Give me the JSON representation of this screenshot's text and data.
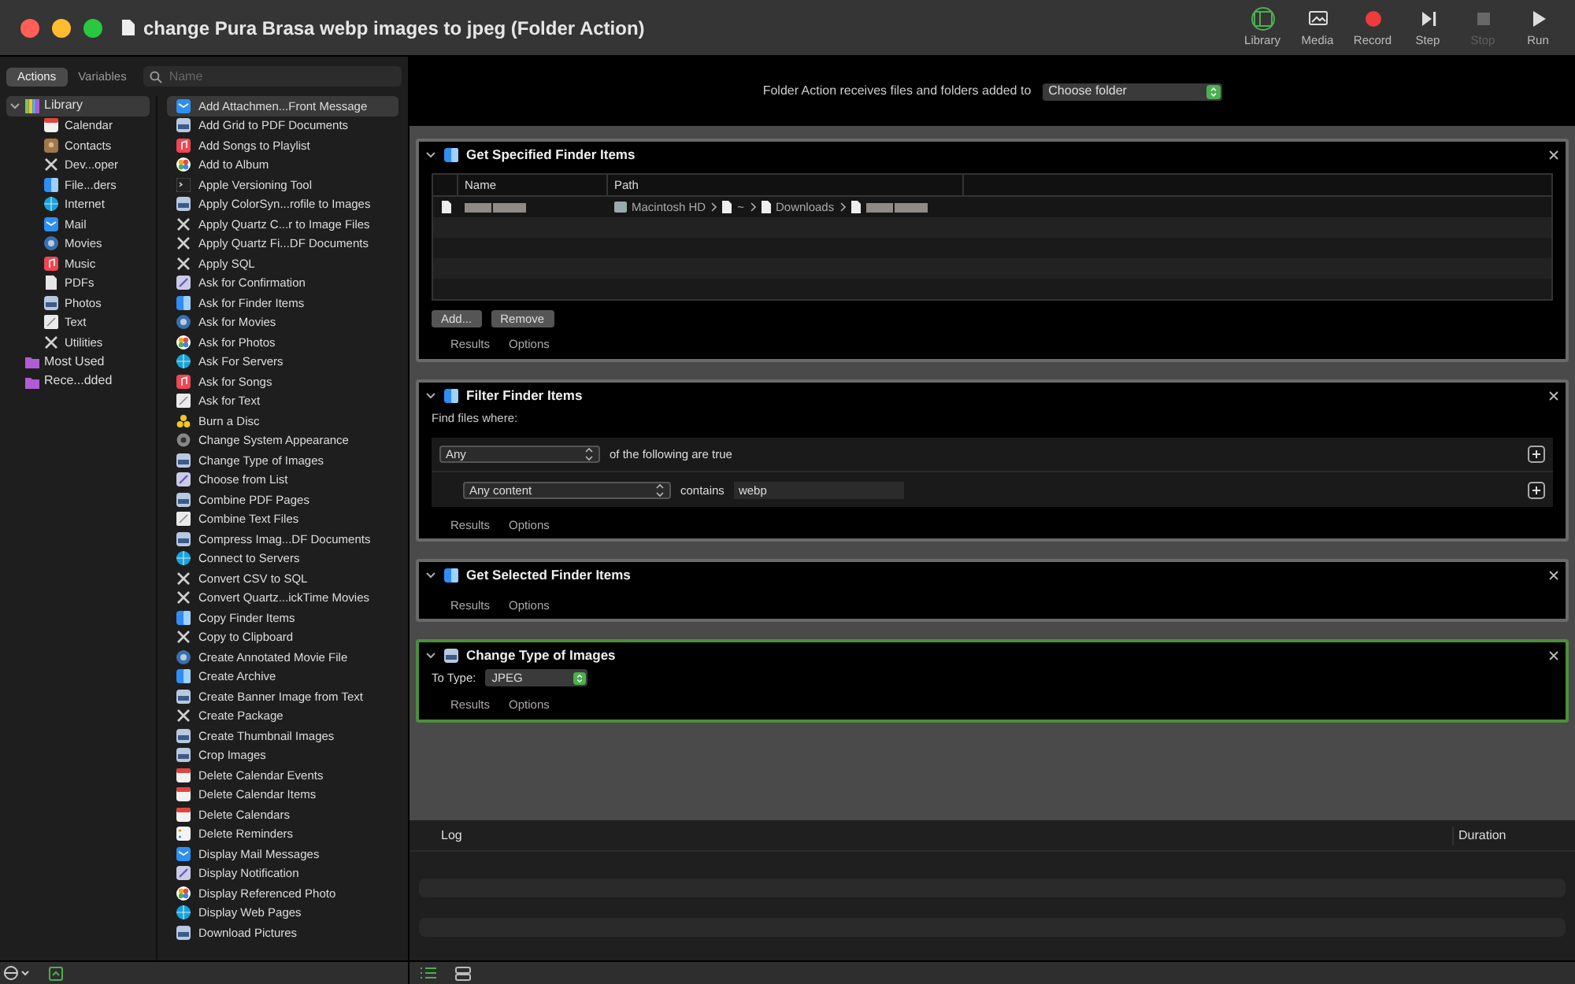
{
  "window": {
    "title": "change Pura Brasa webp images to jpeg (Folder Action)"
  },
  "toolbar": [
    {
      "label": "Library",
      "kind": "library",
      "selected": true,
      "disabled": false
    },
    {
      "label": "Media",
      "kind": "media",
      "selected": false,
      "disabled": false
    },
    {
      "label": "Record",
      "kind": "record",
      "selected": false,
      "disabled": false
    },
    {
      "label": "Step",
      "kind": "step",
      "selected": false,
      "disabled": false
    },
    {
      "label": "Stop",
      "kind": "stop",
      "selected": false,
      "disabled": true
    },
    {
      "label": "Run",
      "kind": "run",
      "selected": false,
      "disabled": false
    }
  ],
  "sidebar_tabs": [
    {
      "label": "Actions",
      "selected": true
    },
    {
      "label": "Variables",
      "selected": false
    }
  ],
  "search": {
    "placeholder": "Name"
  },
  "library": [
    {
      "label": "Library",
      "kind": "library",
      "selected": true,
      "expanded": true,
      "children": [
        {
          "label": "Calendar",
          "kind": "calendar"
        },
        {
          "label": "Contacts",
          "kind": "contacts"
        },
        {
          "label": "Dev...oper",
          "kind": "tools"
        },
        {
          "label": "File...ders",
          "kind": "finder"
        },
        {
          "label": "Internet",
          "kind": "internet"
        },
        {
          "label": "Mail",
          "kind": "mail"
        },
        {
          "label": "Movies",
          "kind": "movies"
        },
        {
          "label": "Music",
          "kind": "music"
        },
        {
          "label": "PDFs",
          "kind": "pdf"
        },
        {
          "label": "Photos",
          "kind": "preview"
        },
        {
          "label": "Text",
          "kind": "text"
        },
        {
          "label": "Utilities",
          "kind": "tools"
        }
      ]
    },
    {
      "label": "Most Used",
      "kind": "folder",
      "selected": false
    },
    {
      "label": "Rece...dded",
      "kind": "folder",
      "selected": false
    }
  ],
  "actions": [
    {
      "label": "Add Attachmen...Front Message",
      "kind": "mail",
      "selected": true
    },
    {
      "label": "Add Grid to PDF Documents",
      "kind": "preview",
      "selected": false
    },
    {
      "label": "Add Songs to Playlist",
      "kind": "music",
      "selected": false
    },
    {
      "label": "Add to Album",
      "kind": "photos",
      "selected": false
    },
    {
      "label": "Apple Versioning Tool",
      "kind": "terminal",
      "selected": false
    },
    {
      "label": "Apply ColorSyn...rofile to Images",
      "kind": "preview",
      "selected": false
    },
    {
      "label": "Apply Quartz C...r to Image Files",
      "kind": "tools",
      "selected": false
    },
    {
      "label": "Apply Quartz Fi...DF Documents",
      "kind": "tools",
      "selected": false
    },
    {
      "label": "Apply SQL",
      "kind": "tools",
      "selected": false
    },
    {
      "label": "Ask for Confirmation",
      "kind": "automator",
      "selected": false
    },
    {
      "label": "Ask for Finder Items",
      "kind": "finder",
      "selected": false
    },
    {
      "label": "Ask for Movies",
      "kind": "movies",
      "selected": false
    },
    {
      "label": "Ask for Photos",
      "kind": "photos",
      "selected": false
    },
    {
      "label": "Ask For Servers",
      "kind": "internet",
      "selected": false
    },
    {
      "label": "Ask for Songs",
      "kind": "music",
      "selected": false
    },
    {
      "label": "Ask for Text",
      "kind": "text",
      "selected": false
    },
    {
      "label": "Burn a Disc",
      "kind": "disc",
      "selected": false
    },
    {
      "label": "Change System Appearance",
      "kind": "system",
      "selected": false
    },
    {
      "label": "Change Type of Images",
      "kind": "preview",
      "selected": false
    },
    {
      "label": "Choose from List",
      "kind": "automator",
      "selected": false
    },
    {
      "label": "Combine PDF Pages",
      "kind": "preview",
      "selected": false
    },
    {
      "label": "Combine Text Files",
      "kind": "text",
      "selected": false
    },
    {
      "label": "Compress Imag...DF Documents",
      "kind": "preview",
      "selected": false
    },
    {
      "label": "Connect to Servers",
      "kind": "internet",
      "selected": false
    },
    {
      "label": "Convert CSV to SQL",
      "kind": "tools",
      "selected": false
    },
    {
      "label": "Convert Quartz...ickTime Movies",
      "kind": "tools",
      "selected": false
    },
    {
      "label": "Copy Finder Items",
      "kind": "finder",
      "selected": false
    },
    {
      "label": "Copy to Clipboard",
      "kind": "tools",
      "selected": false
    },
    {
      "label": "Create Annotated Movie File",
      "kind": "movies",
      "selected": false
    },
    {
      "label": "Create Archive",
      "kind": "finder",
      "selected": false
    },
    {
      "label": "Create Banner Image from Text",
      "kind": "preview",
      "selected": false
    },
    {
      "label": "Create Package",
      "kind": "tools",
      "selected": false
    },
    {
      "label": "Create Thumbnail Images",
      "kind": "preview",
      "selected": false
    },
    {
      "label": "Crop Images",
      "kind": "preview",
      "selected": false
    },
    {
      "label": "Delete Calendar Events",
      "kind": "calendar",
      "selected": false
    },
    {
      "label": "Delete Calendar Items",
      "kind": "calendar",
      "selected": false
    },
    {
      "label": "Delete Calendars",
      "kind": "calendar",
      "selected": false
    },
    {
      "label": "Delete Reminders",
      "kind": "reminders",
      "selected": false
    },
    {
      "label": "Display Mail Messages",
      "kind": "mail",
      "selected": false
    },
    {
      "label": "Display Notification",
      "kind": "automator",
      "selected": false
    },
    {
      "label": "Display Referenced Photo",
      "kind": "photos",
      "selected": false
    },
    {
      "label": "Display Web Pages",
      "kind": "internet",
      "selected": false
    },
    {
      "label": "Download Pictures",
      "kind": "preview",
      "selected": false
    }
  ],
  "workflow": {
    "header": {
      "text": "Folder Action receives files and folders added to",
      "folder": "Choose folder"
    },
    "steps": [
      {
        "kind": "file_list",
        "title": "Get Specified Finder Items",
        "expanded": true,
        "selected": false,
        "columns": [
          "Name",
          "Path"
        ],
        "rows": [
          {
            "path": [
              "Macintosh HD",
              "~",
              "Downloads"
            ]
          }
        ],
        "buttons": [
          "Add...",
          "Remove"
        ],
        "tabs": [
          "Results",
          "Options"
        ]
      },
      {
        "kind": "filter",
        "title": "Filter Finder Items",
        "expanded": true,
        "selected": false,
        "label": "Find files where:",
        "rows": [
          {
            "select": "Any",
            "text": "of the following are true"
          },
          {
            "select": "Any content",
            "text": "contains",
            "value": "webp"
          }
        ],
        "tabs": [
          "Results",
          "Options"
        ]
      },
      {
        "kind": "simple",
        "title": "Get Selected Finder Items",
        "expanded": true,
        "selected": false,
        "tabs": [
          "Results",
          "Options"
        ]
      },
      {
        "kind": "change_type",
        "title": "Change Type of Images",
        "expanded": true,
        "selected": true,
        "label": "To Type:",
        "select": "JPEG",
        "tabs": [
          "Results",
          "Options"
        ]
      }
    ]
  },
  "log": {
    "columns": [
      "Log",
      "Duration"
    ]
  }
}
